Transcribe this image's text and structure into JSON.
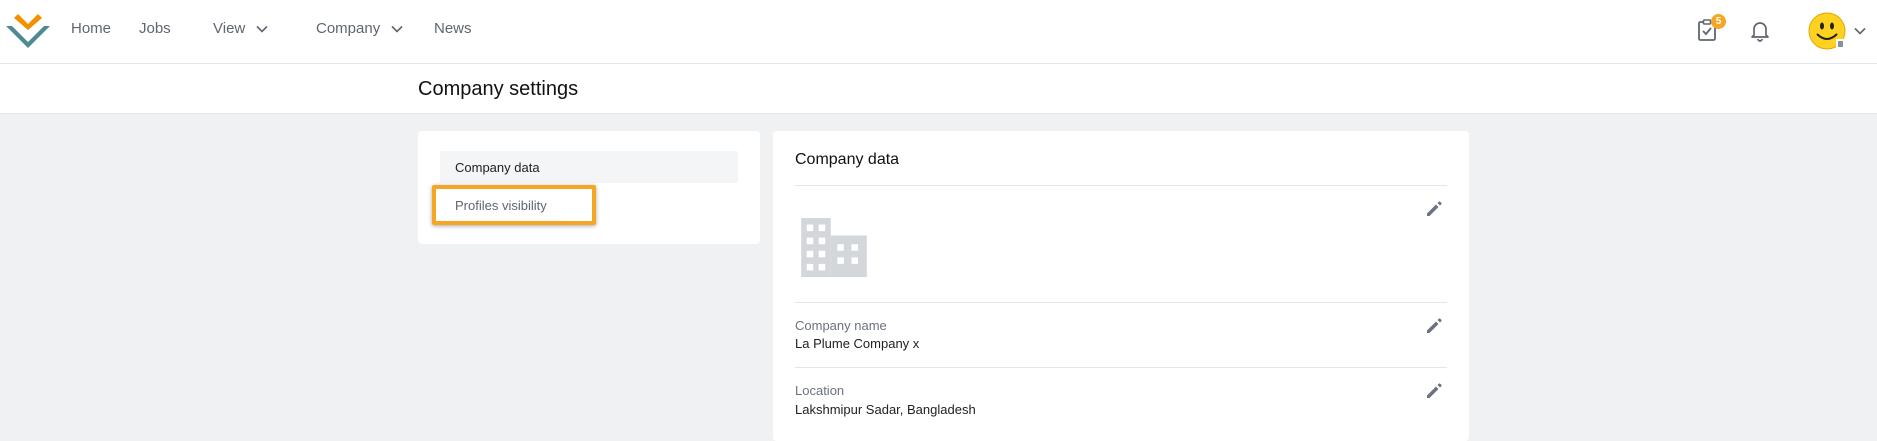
{
  "nav": {
    "items": [
      {
        "label": "Home"
      },
      {
        "label": "Jobs"
      },
      {
        "label": "View"
      },
      {
        "label": "Company"
      },
      {
        "label": "News"
      }
    ],
    "tasks_badge": "5"
  },
  "page": {
    "title": "Company settings"
  },
  "menu": {
    "items": [
      {
        "label": "Company data"
      },
      {
        "label": "Profiles visibility"
      }
    ]
  },
  "content": {
    "title": "Company data",
    "fields": [
      {
        "label": "Company name",
        "value": "La Plume Company x"
      },
      {
        "label": "Location",
        "value": "Lakshmipur Sadar, Bangladesh"
      }
    ]
  },
  "colors": {
    "accent_orange": "#f5a623",
    "logo_teal": "#4f8a93",
    "logo_orange": "#f29100"
  }
}
